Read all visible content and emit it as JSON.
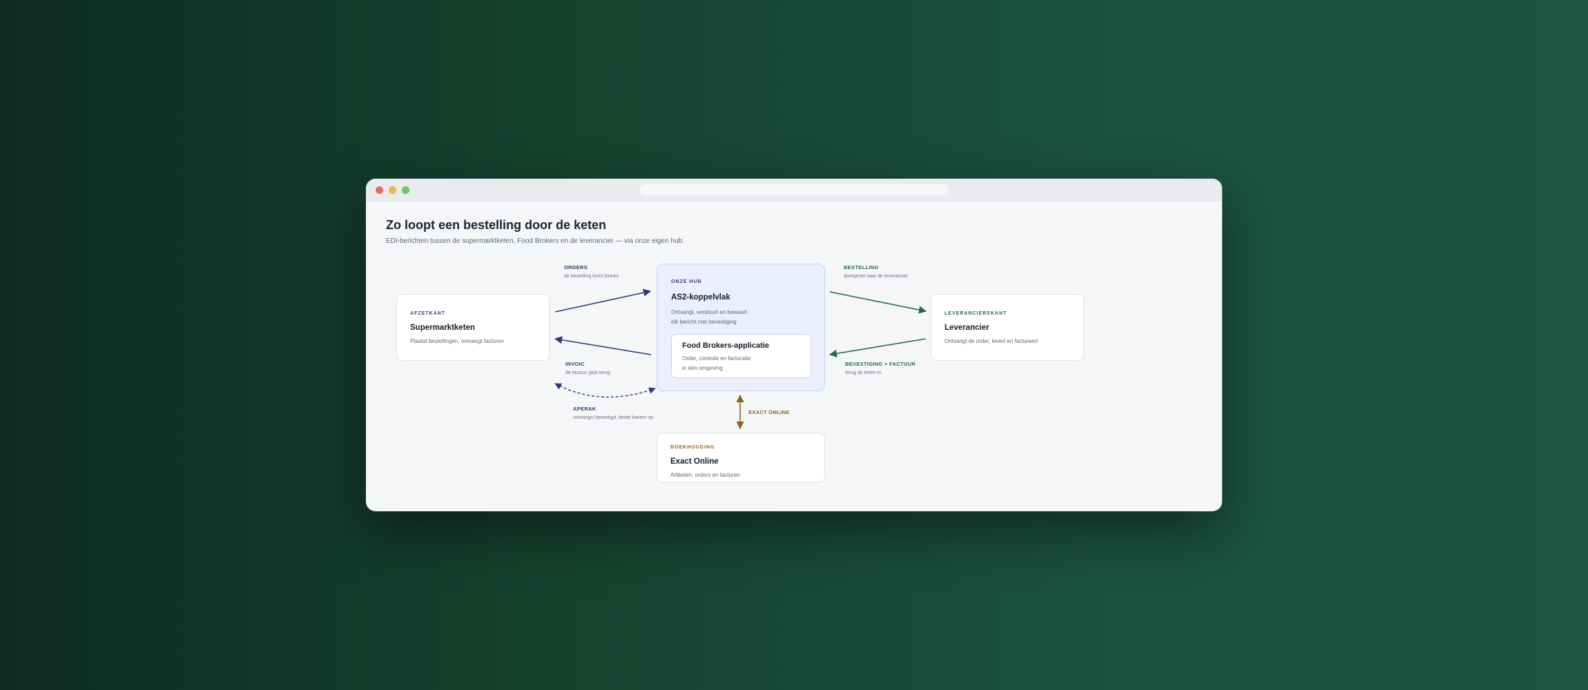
{
  "page": {
    "title": "Zo loopt een bestelling door de keten",
    "subtitle": "EDI-berichten tussen de supermarktketen, Food Brokers en de leverancier — via onze eigen hub."
  },
  "nodes": {
    "supermarket": {
      "eyebrow": "AFZETKANT",
      "title": "Supermarktketen",
      "desc": "Plaatst bestellingen, ontvangt facturen"
    },
    "hub": {
      "eyebrow": "ONZE HUB",
      "title": "AS2-koppelvlak",
      "desc_line1": "Ontvangt, verstuurt en bewaart",
      "desc_line2": "elk bericht met bevestiging",
      "inner": {
        "title": "Food Brokers-applicatie",
        "desc_line1": "Order, controle en facturatie",
        "desc_line2": "in één omgeving"
      }
    },
    "supplier": {
      "eyebrow": "LEVERANCIERSKANT",
      "title": "Leverancier",
      "desc": "Ontvangt de order, levert en factureert"
    },
    "accounting": {
      "eyebrow": "BOEKHOUDING",
      "title": "Exact Online",
      "desc": "Artikelen, orders en facturen"
    }
  },
  "flows": {
    "orders": {
      "label": "ORDERS",
      "sub": "de bestelling komt binnen"
    },
    "invoic": {
      "label": "INVOIC",
      "sub": "de factuur gaat terug"
    },
    "aperak": {
      "label": "APERAK",
      "sub": "ontvangst bevestigd, beide kanten op"
    },
    "bestelling": {
      "label": "BESTELLING",
      "sub": "doorgezet naar de leverancier"
    },
    "bevestiging": {
      "label": "BEVESTIGING + FACTUUR",
      "sub": "terug de keten in"
    },
    "exact": {
      "label": "EXACT ONLINE"
    }
  },
  "colors": {
    "navy": "#2e3a7c",
    "green": "#1f6b4e",
    "gold": "#8a6414"
  }
}
